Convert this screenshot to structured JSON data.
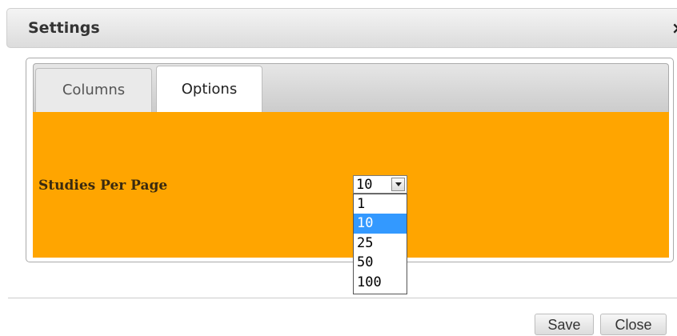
{
  "dialog": {
    "title": "Settings",
    "close_glyph": "×"
  },
  "tabs": [
    {
      "label": "Columns",
      "active": false
    },
    {
      "label": "Options",
      "active": true
    }
  ],
  "options_panel": {
    "background_color": "#ffa500",
    "studies_per_page": {
      "label": "Studies Per Page",
      "selected_value": "10",
      "dropdown_open": true,
      "options": [
        "1",
        "10",
        "25",
        "50",
        "100"
      ],
      "highlighted_option": "10"
    }
  },
  "footer": {
    "save_label": "Save",
    "close_label": "Close"
  },
  "colors": {
    "highlight": "#3399ff"
  }
}
